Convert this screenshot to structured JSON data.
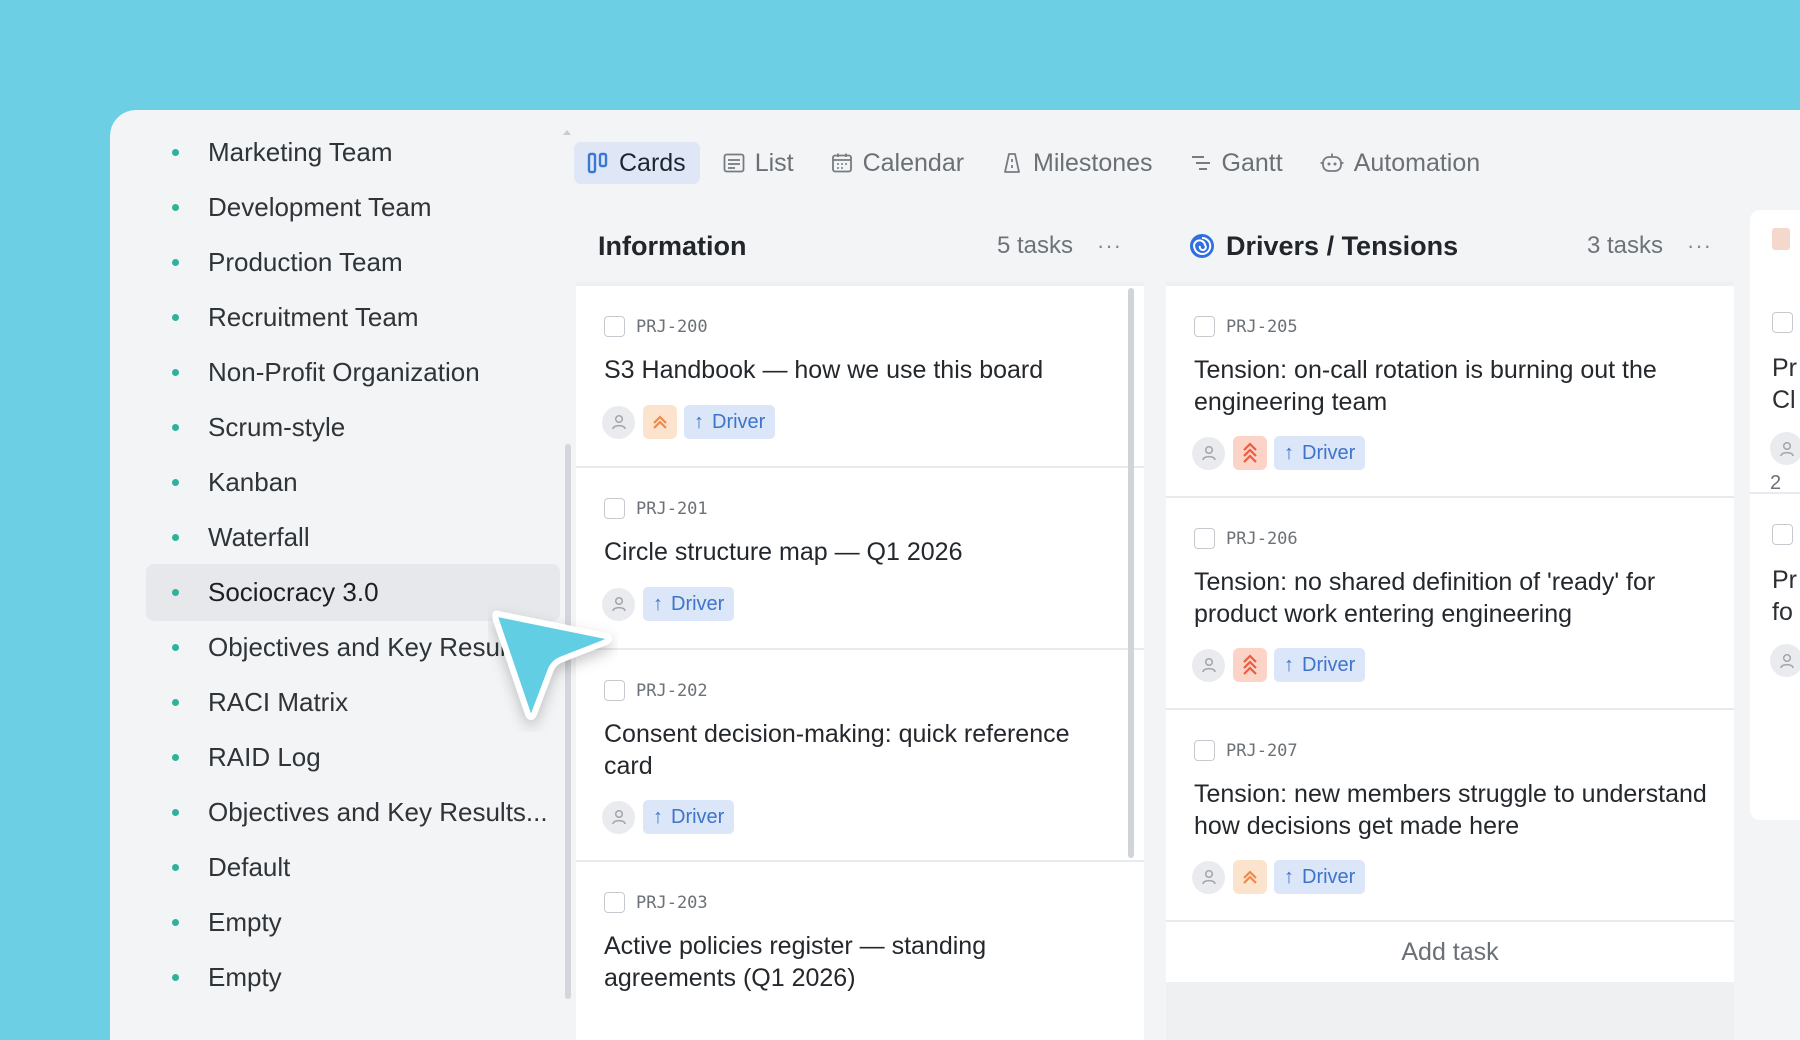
{
  "sidebar": {
    "items": [
      {
        "label": "Marketing Team",
        "active": false
      },
      {
        "label": "Development Team",
        "active": false
      },
      {
        "label": "Production Team",
        "active": false
      },
      {
        "label": "Recruitment Team",
        "active": false
      },
      {
        "label": "Non-Profit Organization",
        "active": false
      },
      {
        "label": "Scrum-style",
        "active": false
      },
      {
        "label": "Kanban",
        "active": false
      },
      {
        "label": "Waterfall",
        "active": false
      },
      {
        "label": "Sociocracy 3.0",
        "active": true
      },
      {
        "label": "Objectives and Key Results",
        "active": false
      },
      {
        "label": "RACI Matrix",
        "active": false
      },
      {
        "label": "RAID Log",
        "active": false
      },
      {
        "label": "Objectives and Key Results...",
        "active": false
      },
      {
        "label": "Default",
        "active": false
      },
      {
        "label": "Empty",
        "active": false
      },
      {
        "label": "Empty",
        "active": false
      }
    ]
  },
  "tabs": [
    {
      "label": "Cards",
      "icon": "cards-icon",
      "active": true
    },
    {
      "label": "List",
      "icon": "list-icon",
      "active": false
    },
    {
      "label": "Calendar",
      "icon": "calendar-icon",
      "active": false
    },
    {
      "label": "Milestones",
      "icon": "milestones-icon",
      "active": false
    },
    {
      "label": "Gantt",
      "icon": "gantt-icon",
      "active": false
    },
    {
      "label": "Automation",
      "icon": "automation-icon",
      "active": false
    }
  ],
  "columns": [
    {
      "title": "Information",
      "count": "5 tasks",
      "more": "···",
      "cards": [
        {
          "id": "PRJ-200",
          "title": "S3 Handbook — how we use this board",
          "priority": "medium",
          "tag": "Driver"
        },
        {
          "id": "PRJ-201",
          "title": "Circle structure map — Q1 2026",
          "priority": null,
          "tag": "Driver"
        },
        {
          "id": "PRJ-202",
          "title": "Consent decision-making: quick reference card",
          "priority": null,
          "tag": "Driver"
        },
        {
          "id": "PRJ-203",
          "title": "Active policies register — standing agreements (Q1 2026)",
          "priority": null,
          "tag": "Driver"
        }
      ]
    },
    {
      "title": "Drivers / Tensions",
      "count": "3 tasks",
      "more": "···",
      "add_task": "Add task",
      "cards": [
        {
          "id": "PRJ-205",
          "title": "Tension: on-call rotation is burning out the engineering team",
          "priority": "high",
          "tag": "Driver"
        },
        {
          "id": "PRJ-206",
          "title": "Tension: no shared definition of 'ready' for product work entering engineering",
          "priority": "high",
          "tag": "Driver"
        },
        {
          "id": "PRJ-207",
          "title": "Tension: new members struggle to understand how decisions get made here",
          "priority": "medium",
          "tag": "Driver"
        }
      ]
    }
  ],
  "partial_column": {
    "text_1": "Pr",
    "text_2": "Cl",
    "count_fragment": "2",
    "text_3": "Pr",
    "text_4": "fo"
  },
  "colors": {
    "background": "#6ccfe3",
    "accent_blue": "#3e74c9",
    "priority_high": "#f0684a",
    "priority_medium": "#f39150",
    "sidebar_dot": "#2db39a",
    "cursor": "#62cee3"
  }
}
